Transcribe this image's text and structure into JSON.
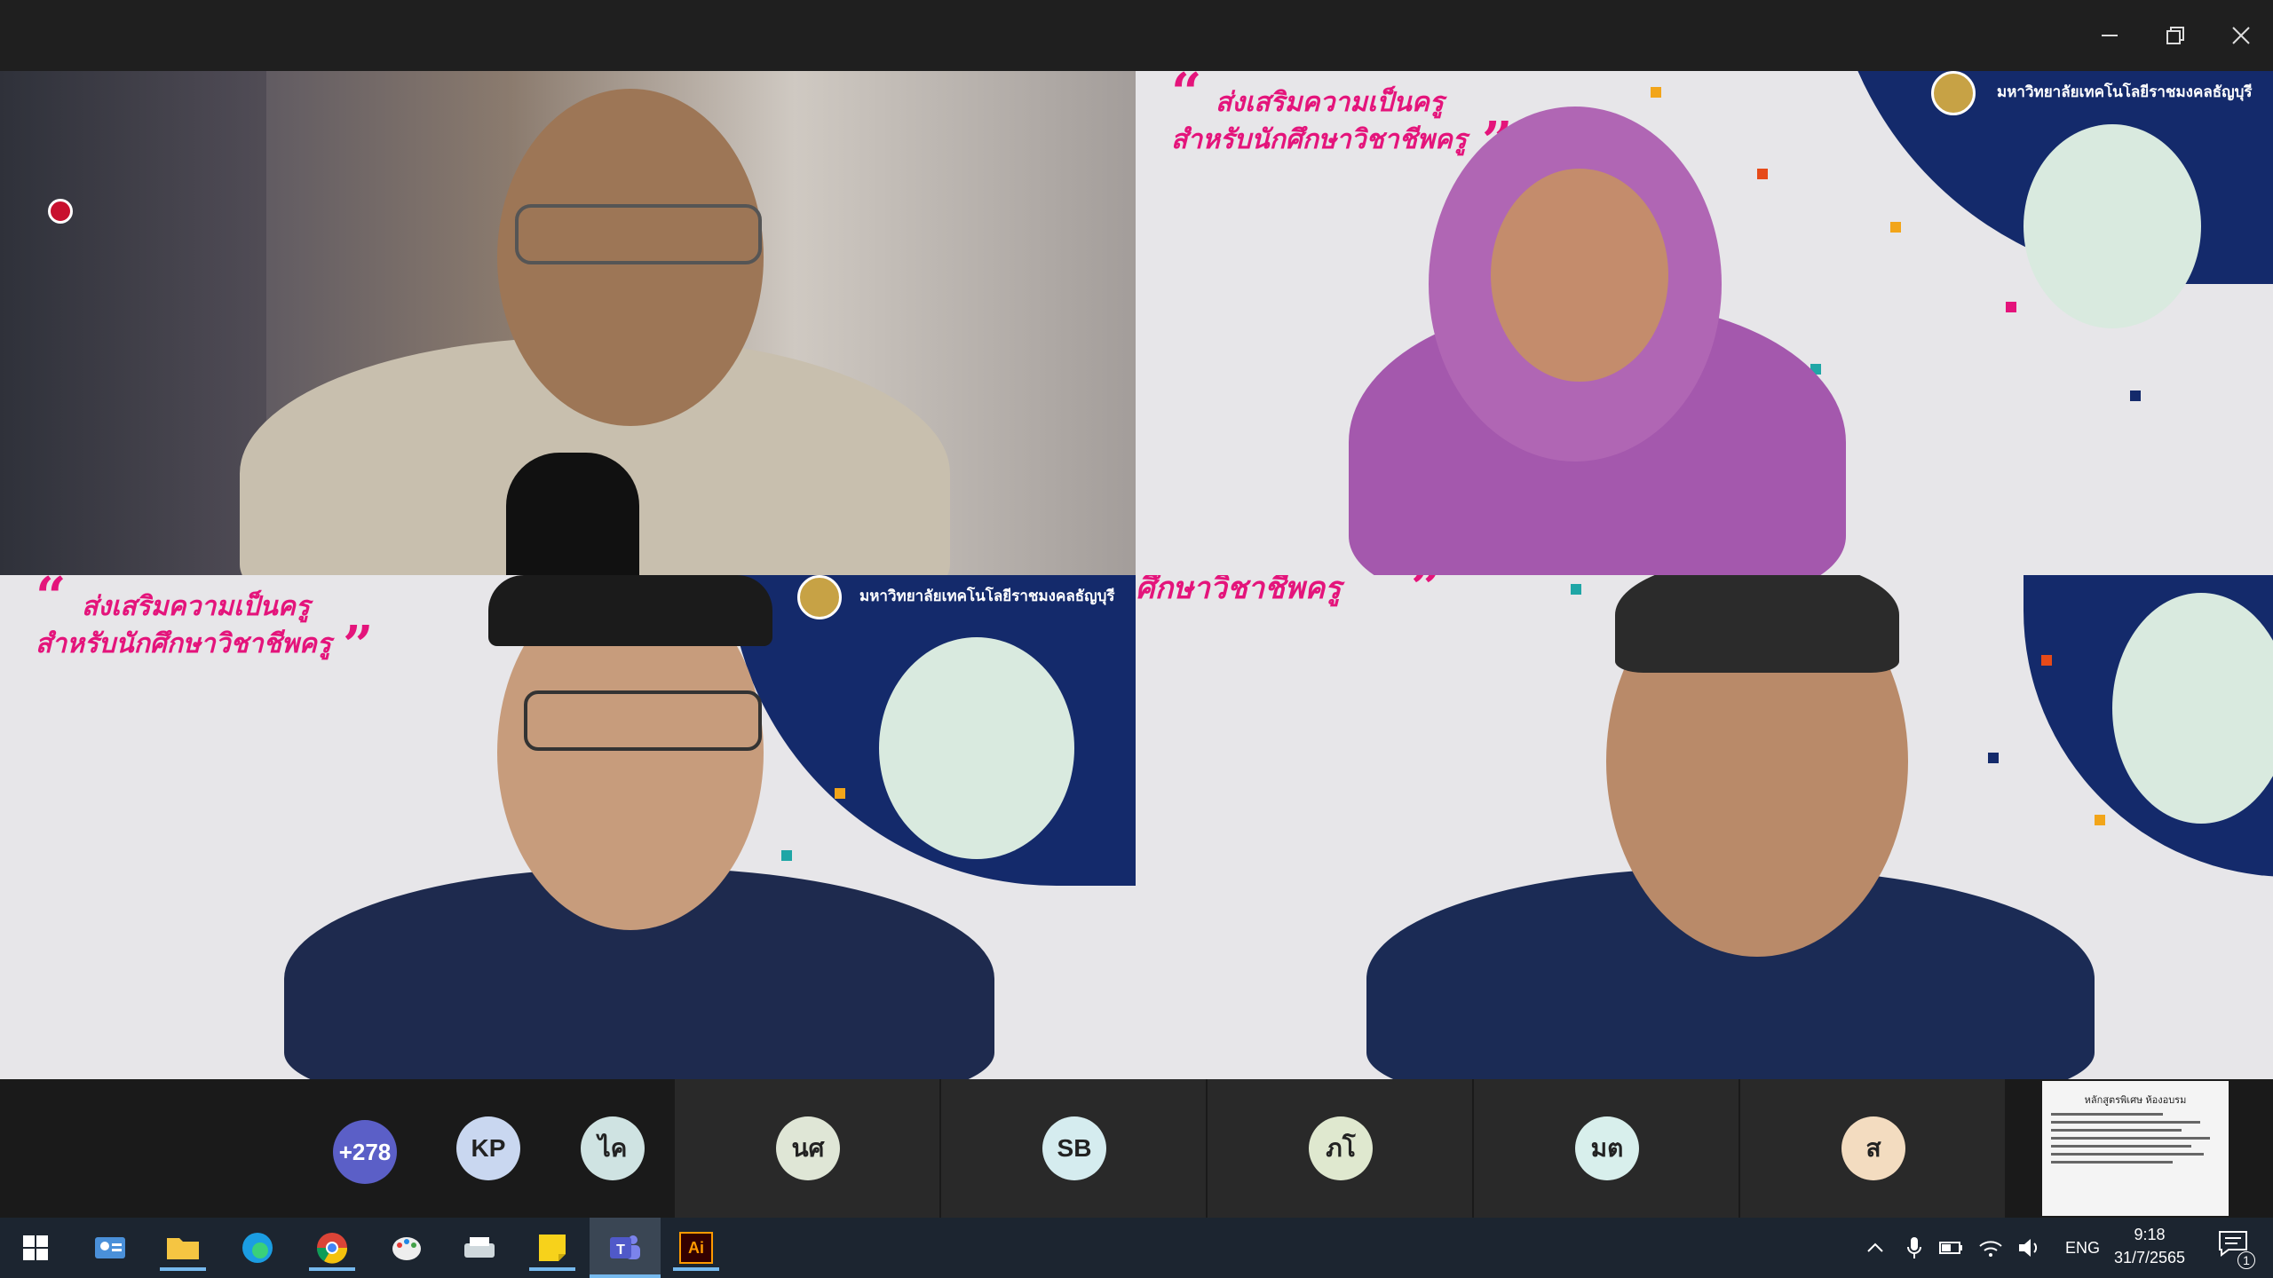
{
  "window": {
    "controls": {
      "minimize": "minimize-icon",
      "restore": "restore-icon",
      "close": "close-icon"
    }
  },
  "recording_indicator": "record-icon",
  "video_tiles": [
    {
      "id": "speaker-1",
      "background": "room"
    },
    {
      "id": "speaker-2",
      "background": "banner"
    },
    {
      "id": "speaker-3",
      "background": "banner"
    },
    {
      "id": "speaker-4",
      "background": "banner"
    }
  ],
  "banner": {
    "line1": "ส่งเสริมความเป็นครู",
    "line2": "สำหรับนักศึกษาวิชาชีพครู",
    "partial_line": "ศึกษาวิชาชีพครู",
    "university": "มหาวิทยาลัยเทคโนโลยีราชมงคลธัญบุรี",
    "open_quote": "“",
    "close_quote": "”",
    "accent_color": "#e4147b",
    "swoop_color": "#142a6b"
  },
  "participants": {
    "overflow_count": "+278",
    "avatars": [
      {
        "initials": "KP",
        "color": "#c9d7f0"
      },
      {
        "initials": "ไค",
        "color": "#cfe3e2"
      },
      {
        "initials": "นศ",
        "color": "#dfe6d6"
      },
      {
        "initials": "SB",
        "color": "#d5ecef"
      },
      {
        "initials": "ภโ",
        "color": "#dfe8cf"
      },
      {
        "initials": "มต",
        "color": "#d8efec"
      },
      {
        "initials": "ส",
        "color": "#f3dcc0"
      }
    ],
    "overflow_color": "#5b5fc7"
  },
  "shared_doc": {
    "title": "หลักสูตรพิเศษ ห้องอบรม"
  },
  "taskbar": {
    "apps": [
      {
        "name": "start-icon"
      },
      {
        "name": "contacts-icon"
      },
      {
        "name": "file-explorer-icon"
      },
      {
        "name": "edge-icon"
      },
      {
        "name": "chrome-icon"
      },
      {
        "name": "paint-icon"
      },
      {
        "name": "scanner-icon"
      },
      {
        "name": "sticky-notes-icon"
      },
      {
        "name": "teams-icon"
      },
      {
        "name": "illustrator-icon",
        "label": "Ai"
      }
    ],
    "tray": {
      "language": "ENG",
      "time": "9:18",
      "date": "31/7/2565",
      "notification_count": "1"
    }
  }
}
